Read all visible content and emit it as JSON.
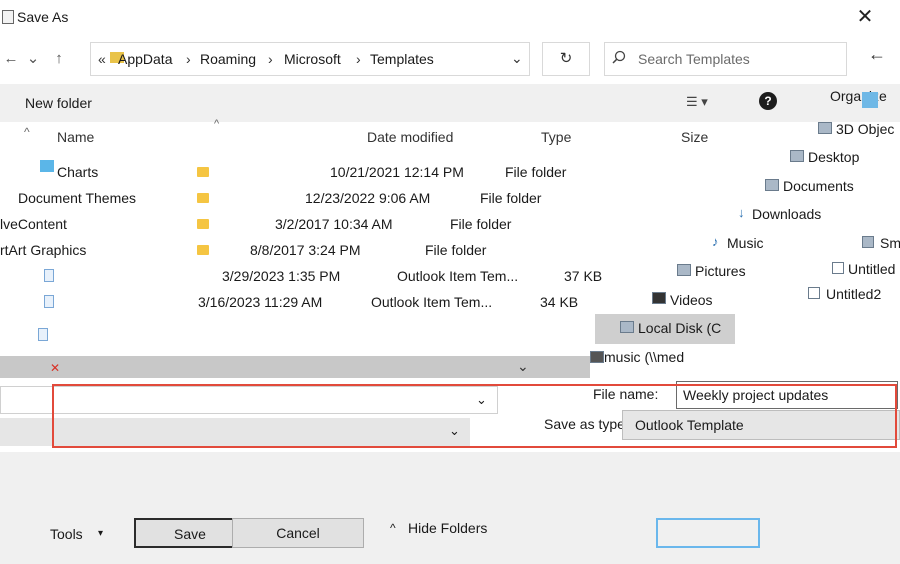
{
  "window": {
    "title": "Save As",
    "close_glyph": "✕"
  },
  "nav": {
    "back_glyph": "←",
    "forward_glyph": "→",
    "recent_glyph": "⌄",
    "up_glyph": "↑",
    "path_overflow": "«",
    "path": [
      "AppData",
      "Roaming",
      "Microsoft",
      "Templates"
    ],
    "path_separator": "›",
    "address_dropdown_glyph": "⌄",
    "refresh_glyph": "↻",
    "search_placeholder": "Search Templates",
    "right_edge_glyph": "←"
  },
  "toolbar": {
    "new_folder": "New folder",
    "view_glyph": "☰ ▾",
    "help_glyph": "?",
    "organize": "Organize"
  },
  "columns": {
    "name": "Name",
    "date_modified": "Date modified",
    "type": "Type",
    "size": "Size",
    "sort_glyph": "^"
  },
  "files": [
    {
      "name": "Charts",
      "date": "10/21/2021 12:14 PM",
      "type": "File folder",
      "size": "",
      "kind": "folder"
    },
    {
      "name": "Document Themes",
      "date": "12/23/2022 9:06 AM",
      "type": "File folder",
      "size": "",
      "kind": "folder"
    },
    {
      "name": "lveContent",
      "date": "3/2/2017 10:34 AM",
      "type": "File folder",
      "size": "",
      "kind": "folder"
    },
    {
      "name": "rtArt Graphics",
      "date": "8/8/2017 3:24 PM",
      "type": "File folder",
      "size": "",
      "kind": "folder"
    },
    {
      "name": "",
      "date": "3/29/2023 1:35 PM",
      "type": "Outlook Item Tem...",
      "size": "37 KB",
      "kind": "file"
    },
    {
      "name": "",
      "date": "3/16/2023 11:29 AM",
      "type": "Outlook Item Tem...",
      "size": "34 KB",
      "kind": "file"
    }
  ],
  "nav_pane": [
    {
      "label": "3D Objec",
      "icon": "cube-icon"
    },
    {
      "label": "Desktop",
      "icon": "desktop-icon"
    },
    {
      "label": "Documents",
      "icon": "documents-icon"
    },
    {
      "label": "Downloads",
      "icon": "download-icon"
    },
    {
      "label": "Music",
      "icon": "music-icon"
    },
    {
      "label": "Pictures",
      "icon": "pictures-icon"
    },
    {
      "label": "Videos",
      "icon": "videos-icon"
    },
    {
      "label": "Local Disk (C",
      "icon": "disk-icon"
    },
    {
      "label": "music (\\\\med",
      "icon": "network-drive-icon"
    }
  ],
  "side_right": [
    {
      "label": "Sm"
    },
    {
      "label": "Untitled"
    },
    {
      "label": "Untitled2"
    }
  ],
  "form": {
    "file_name_label": "File name:",
    "file_name_value": "Weekly project updates",
    "save_as_type_label": "Save as type:",
    "save_as_type_value": "Outlook Template",
    "dropdown_glyph": "⌄"
  },
  "footer": {
    "tools": "Tools",
    "tools_caret": "▾",
    "save": "Save",
    "cancel": "Cancel",
    "hide_folders_glyph": "^",
    "hide_folders": "Hide Folders"
  }
}
